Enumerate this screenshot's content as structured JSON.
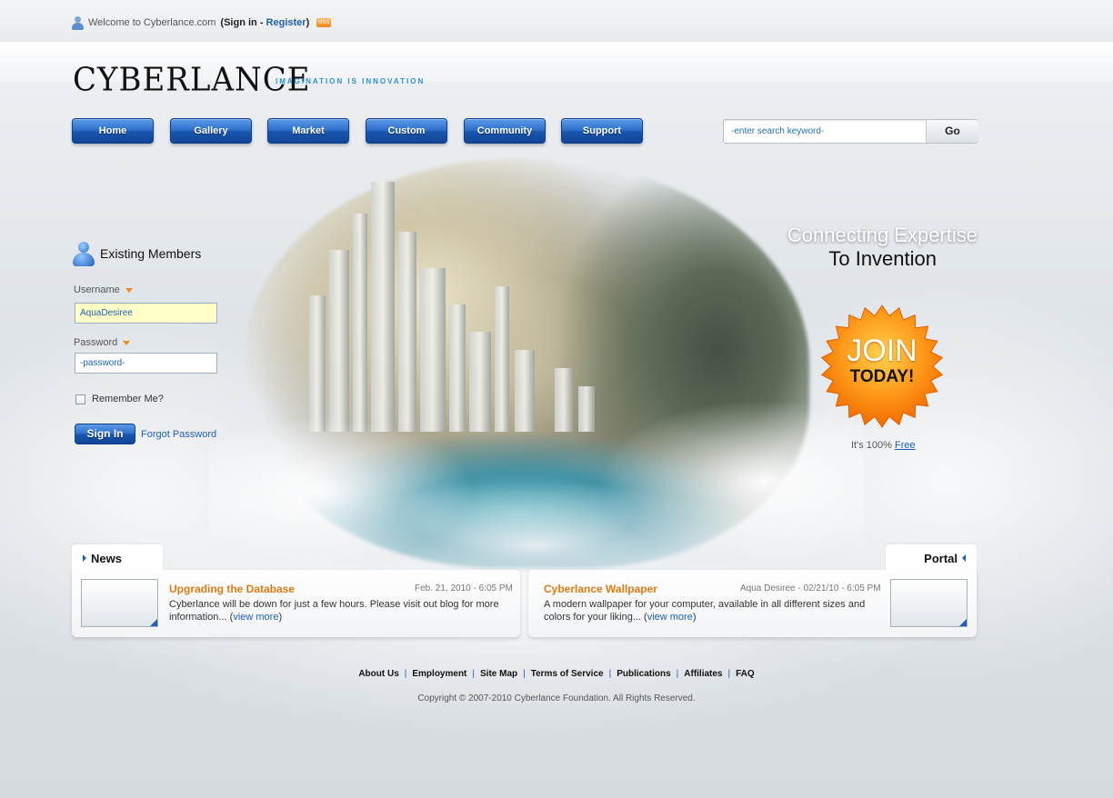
{
  "topbar": {
    "welcome": "Welcome to Cyberlance.com",
    "open_paren": "(",
    "sign_in": "Sign in",
    "dash": "-",
    "register": "Register",
    "close_paren": ")"
  },
  "brand": {
    "logo": "CYBERLANCE",
    "tagline": "IMAGINATION IS INNOVATION"
  },
  "nav": [
    {
      "label": "Home"
    },
    {
      "label": "Gallery"
    },
    {
      "label": "Market"
    },
    {
      "label": "Custom"
    },
    {
      "label": "Community"
    },
    {
      "label": "Support"
    }
  ],
  "search": {
    "placeholder": "-enter search keyword-",
    "button": "Go"
  },
  "login": {
    "title": "Existing Members",
    "username_label": "Username",
    "username_value": "AquaDesiree",
    "password_label": "Password",
    "password_placeholder": "-password-",
    "remember": "Remember Me?",
    "signin": "Sign In",
    "forgot": "Forgot Password"
  },
  "hero": {
    "slogan_line1": "Connecting Expertise",
    "slogan_line2": "To Invention",
    "join": "JOIN",
    "join_sub": "TODAY!",
    "free_prefix": "It's 100%",
    "free_link": "Free"
  },
  "news": {
    "tab": "News",
    "title": "Upgrading the Database",
    "meta": "Feb. 21, 2010 - 6:05 PM",
    "body": "Cyberlance will be down for just a few hours. Please visit out blog for more information... (",
    "link": "view more",
    "close": ")"
  },
  "portal": {
    "tab": "Portal",
    "title": "Cyberlance Wallpaper",
    "meta": "Aqua Desiree - 02/21/10 - 6:05 PM",
    "body": "A modern wallpaper for your computer, available in all different sizes and colors for your liking... (",
    "link": "view more",
    "close": ")"
  },
  "footer": {
    "links": [
      "About Us",
      "Employment",
      "Site Map",
      "Terms of Service",
      "Publications",
      "Affiliates",
      "FAQ"
    ],
    "separator": "|",
    "copyright": "Copyright © 2007-2010 Cyberlance Foundation. All Rights Reserved."
  },
  "colors": {
    "accent_blue": "#1f5fb5",
    "accent_orange": "#e27a12",
    "nav_blue": "#2c6fcb"
  }
}
